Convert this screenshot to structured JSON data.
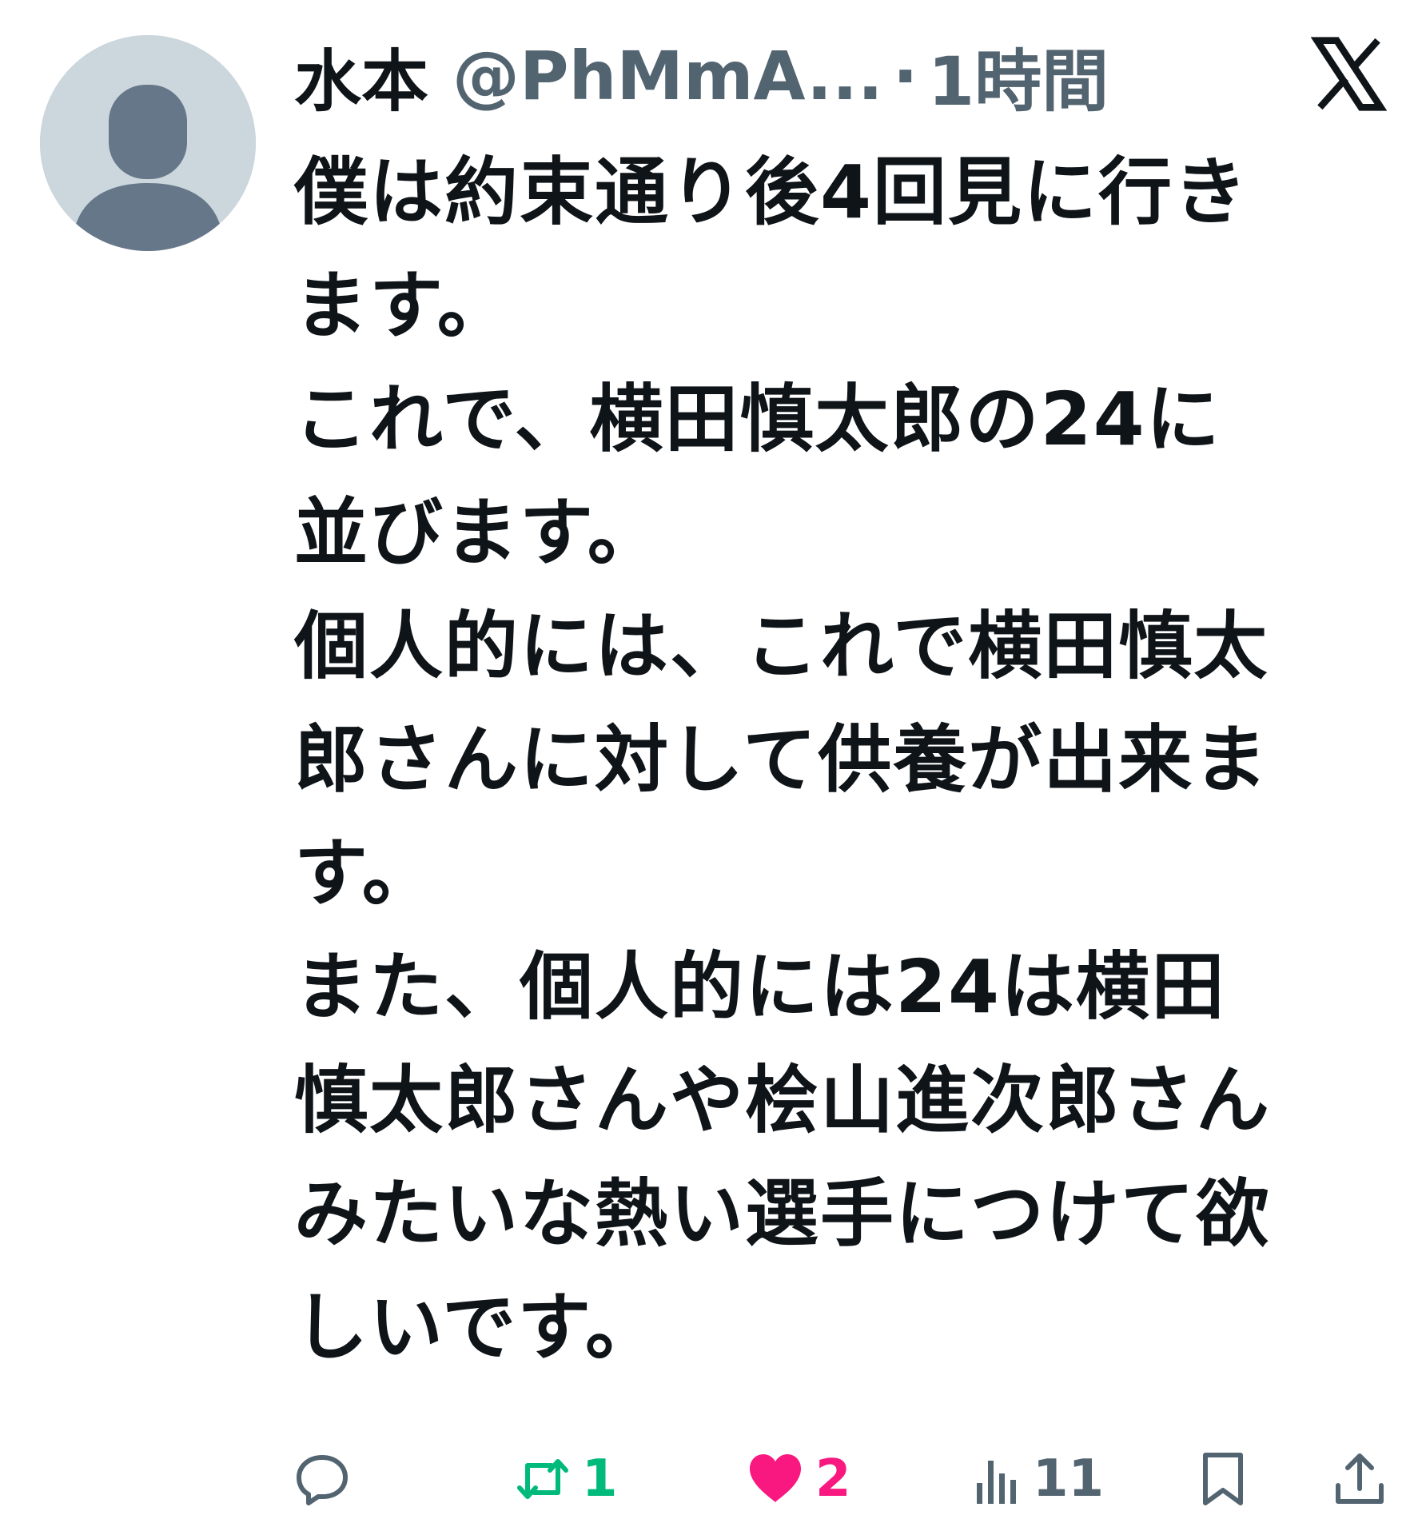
{
  "author": {
    "name": "水本",
    "handle": "@PhMmA...",
    "separator": "·",
    "time": "1時間"
  },
  "icons": {
    "avatar": "default-profile-icon",
    "logo": "x-logo-icon",
    "reply": "reply-bubble-icon",
    "retweet": "retweet-icon",
    "like": "heart-filled-icon",
    "views": "views-bar-chart-icon",
    "bookmark": "bookmark-icon",
    "share": "share-upload-icon"
  },
  "body": {
    "lines": [
      "僕は約束通り後4回見に行き",
      "ます。",
      "これで、横田慎太郎の24に",
      "並びます。",
      "個人的には、これで横田慎太",
      "郎さんに対して供養が出来ま",
      "す。",
      "また、個人的には24は横田",
      "慎太郎さんや桧山進次郎さん",
      "みたいな熱い選手につけて欲",
      "しいです。"
    ]
  },
  "actions": {
    "retweets": "1",
    "likes": "2",
    "views": "11"
  },
  "colors": {
    "text": "#0f1419",
    "secondary": "#536471",
    "retweet_active": "#00ba7c",
    "like_active": "#f91880",
    "avatar_bg": "#ccd6dd",
    "avatar_fg": "#66778a"
  }
}
